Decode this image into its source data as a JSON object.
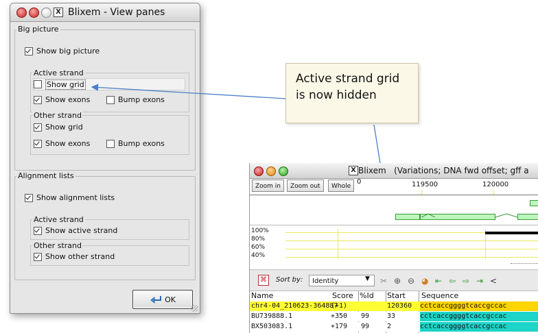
{
  "dialog": {
    "title": "Blixem - View panes",
    "big_picture": {
      "group_label": "Big picture",
      "show_big_picture": {
        "label": "Show big picture",
        "checked": true
      },
      "active_strand": {
        "label": "Active strand",
        "show_grid": {
          "label": "Show grid",
          "checked": false
        },
        "show_exons": {
          "label": "Show exons",
          "checked": true
        },
        "bump_exons": {
          "label": "Bump exons",
          "checked": false
        }
      },
      "other_strand": {
        "label": "Other strand",
        "show_grid": {
          "label": "Show grid",
          "checked": true
        },
        "show_exons": {
          "label": "Show exons",
          "checked": true
        },
        "bump_exons": {
          "label": "Bump exons",
          "checked": false
        }
      }
    },
    "alignment_lists": {
      "group_label": "Alignment lists",
      "show_alignment_lists": {
        "label": "Show alignment lists",
        "checked": true
      },
      "active_strand": {
        "label": "Active strand",
        "show": {
          "label": "Show active strand",
          "checked": true
        }
      },
      "other_strand": {
        "label": "Other strand",
        "show": {
          "label": "Show other strand",
          "checked": true
        }
      }
    },
    "ok_label": "OK"
  },
  "callout": {
    "text": "Active strand grid is now hidden"
  },
  "blixem": {
    "title": "Blixem",
    "title_rest": "(Variations; DNA fwd offset; gff a",
    "zoom_in": "Zoom in",
    "zoom_out": "Zoom out",
    "whole": "Whole",
    "ruler": [
      "0",
      "119500",
      "120000"
    ],
    "percent_labels": [
      "100%",
      "80%",
      "60%",
      "40%"
    ],
    "sort_by_label": "Sort by:",
    "sort_by_value": "Identity",
    "columns": [
      "Name",
      "Score",
      "%Id",
      "Start",
      "Sequence"
    ],
    "rows": [
      {
        "name": "chr4-04_210623-364887",
        "score": "(+1)",
        "id": "",
        "start": "120360",
        "seq": "cctcaccggggtcaccgccac",
        "name_bg": "#ffff33",
        "seq_bg": "#ffd400"
      },
      {
        "name": "BU739888.1",
        "score": "+350",
        "id": "99",
        "start": "33",
        "seq": "cctcaccggggtcaccgccac",
        "name_bg": "#ffffff",
        "seq_bg": "#1ed3c8"
      },
      {
        "name": "BX503083.1",
        "score": "+179",
        "id": "99",
        "start": "2",
        "seq": "cctcaccggggtcaccgccac",
        "name_bg": "#ffffff",
        "seq_bg": "#1ed3c8"
      }
    ],
    "colors": {
      "exon_fill": "#bdf6bd",
      "grid": "#e8e85a",
      "arrow": "#4a7fc8"
    }
  }
}
